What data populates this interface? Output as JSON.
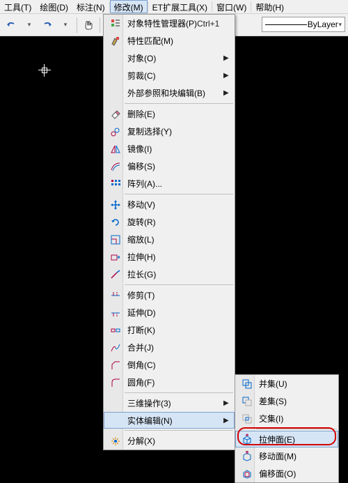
{
  "menubar": {
    "tools": "工具(T)",
    "draw": "绘图(D)",
    "dim": "标注(N)",
    "modify": "修改(M)",
    "et": "ET扩展工具(X)",
    "window": "窗口(W)",
    "help": "帮助(H)"
  },
  "toolbar": {
    "bylayer": "ByLayer"
  },
  "menu": {
    "prop_mgr": {
      "label": "对象特性管理器(P)",
      "shortcut": "Ctrl+1"
    },
    "match": "特性匹配(M)",
    "object": "对象(O)",
    "clip": "剪裁(C)",
    "xref": "外部参照和块编辑(B)",
    "erase": "删除(E)",
    "copy": "复制选择(Y)",
    "mirror": "镜像(I)",
    "offset": "偏移(S)",
    "array": "阵列(A)...",
    "move": "移动(V)",
    "rotate": "旋转(R)",
    "scale": "缩放(L)",
    "stretch": "拉伸(H)",
    "lengthen": "拉长(G)",
    "trim": "修剪(T)",
    "extend": "延伸(D)",
    "break": "打断(K)",
    "join": "合并(J)",
    "chamfer": "倒角(C)",
    "fillet": "圆角(F)",
    "threed": "三维操作(3)",
    "solidedit": "实体编辑(N)",
    "explode": "分解(X)"
  },
  "submenu": {
    "union": "并集(U)",
    "subtract": "差集(S)",
    "intersect": "交集(I)",
    "extrudeface": "拉伸面(E)",
    "moveface": "移动面(M)",
    "offsetface": "偏移面(O)"
  }
}
